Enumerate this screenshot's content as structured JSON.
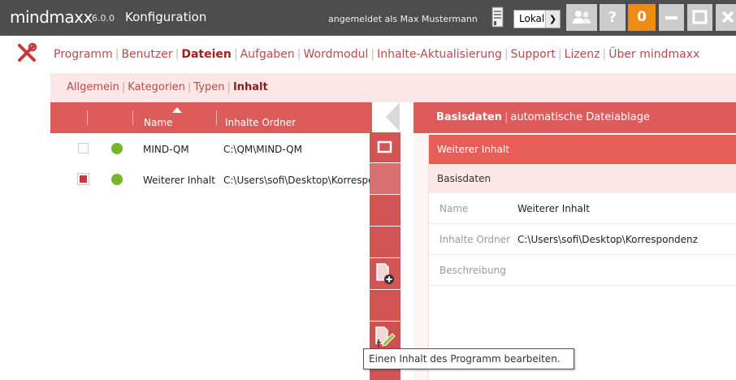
{
  "app": {
    "brand": "mindmaxx",
    "version": "6.0.0",
    "window_title": "Konfiguration",
    "user_text": "angemeldet als Max Mustermann",
    "location_select": "Lokal",
    "help_label": "?",
    "notification_count": "0",
    "accent_color": "#dc5b5b",
    "notification_color": "#f08a13"
  },
  "main_menu": {
    "items": [
      {
        "label": "Programm"
      },
      {
        "label": "Benutzer"
      },
      {
        "label": "Dateien",
        "active": true
      },
      {
        "label": "Aufgaben"
      },
      {
        "label": "Wordmodul"
      },
      {
        "label": "Inhalte-Aktualisierung"
      },
      {
        "label": "Support"
      },
      {
        "label": "Lizenz"
      },
      {
        "label": "Über mindmaxx"
      }
    ]
  },
  "sub_menu": {
    "items": [
      {
        "label": "Allgemein"
      },
      {
        "label": "Kategorien"
      },
      {
        "label": "Typen"
      },
      {
        "label": "Inhalt",
        "active": true
      }
    ]
  },
  "table": {
    "columns": {
      "name": "Name",
      "folder": "Inhalte Ordner"
    },
    "rows": [
      {
        "checked": false,
        "status": "active",
        "name": "MIND-QM",
        "folder": "C:\\QM\\MIND-QM"
      },
      {
        "checked": true,
        "status": "active",
        "name": "Weiterer Inhalt",
        "folder": "C:\\Users\\sofi\\Desktop\\Korrespondenz"
      }
    ]
  },
  "side_toolbar": {
    "icons": [
      "square-icon",
      "add-document-icon",
      "edit-document-icon"
    ]
  },
  "detail": {
    "tab_basisdaten": "Basisdaten",
    "tab_ablage": "automatische Dateiablage",
    "selected_title": "Weiterer Inhalt",
    "section_title": "Basisdaten",
    "fields": [
      {
        "label": "Name",
        "value": "Weiterer Inhalt"
      },
      {
        "label": "Inhalte Ordner",
        "value": "C:\\Users\\sofi\\Desktop\\Korrespondenz"
      },
      {
        "label": "Beschreibung",
        "value": ""
      }
    ]
  },
  "tooltip": {
    "text": "Einen Inhalt des Programm bearbeiten."
  }
}
